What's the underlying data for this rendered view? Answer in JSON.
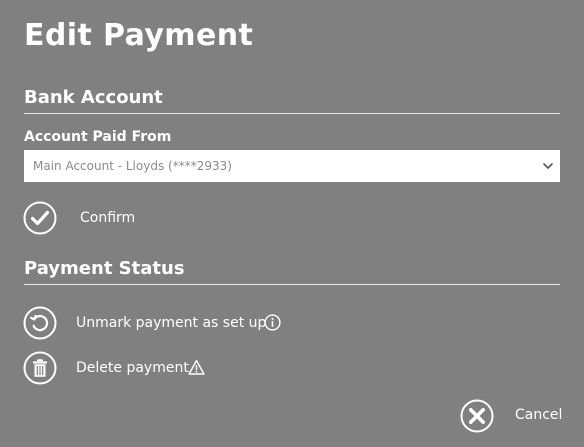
{
  "title": "Edit Payment",
  "bank_account": {
    "heading": "Bank Account",
    "field_label": "Account Paid From",
    "selected_account": "Main Account - Lloyds (****2933)",
    "confirm_label": "Confirm"
  },
  "payment_status": {
    "heading": "Payment Status",
    "unmark_label": "Unmark payment as set up",
    "delete_label": "Delete payment"
  },
  "footer": {
    "cancel_label": "Cancel"
  },
  "icons": {
    "confirm": "check-circle-icon",
    "unmark": "undo-circle-icon",
    "info": "info-icon",
    "delete": "trash-icon",
    "warning": "warning-icon",
    "cancel": "close-circle-icon",
    "select": "chevron-down-icon"
  },
  "colors": {
    "background": "#808080",
    "text": "#ffffff",
    "select_background": "#ffffff",
    "select_text": "#8a8a8a"
  }
}
